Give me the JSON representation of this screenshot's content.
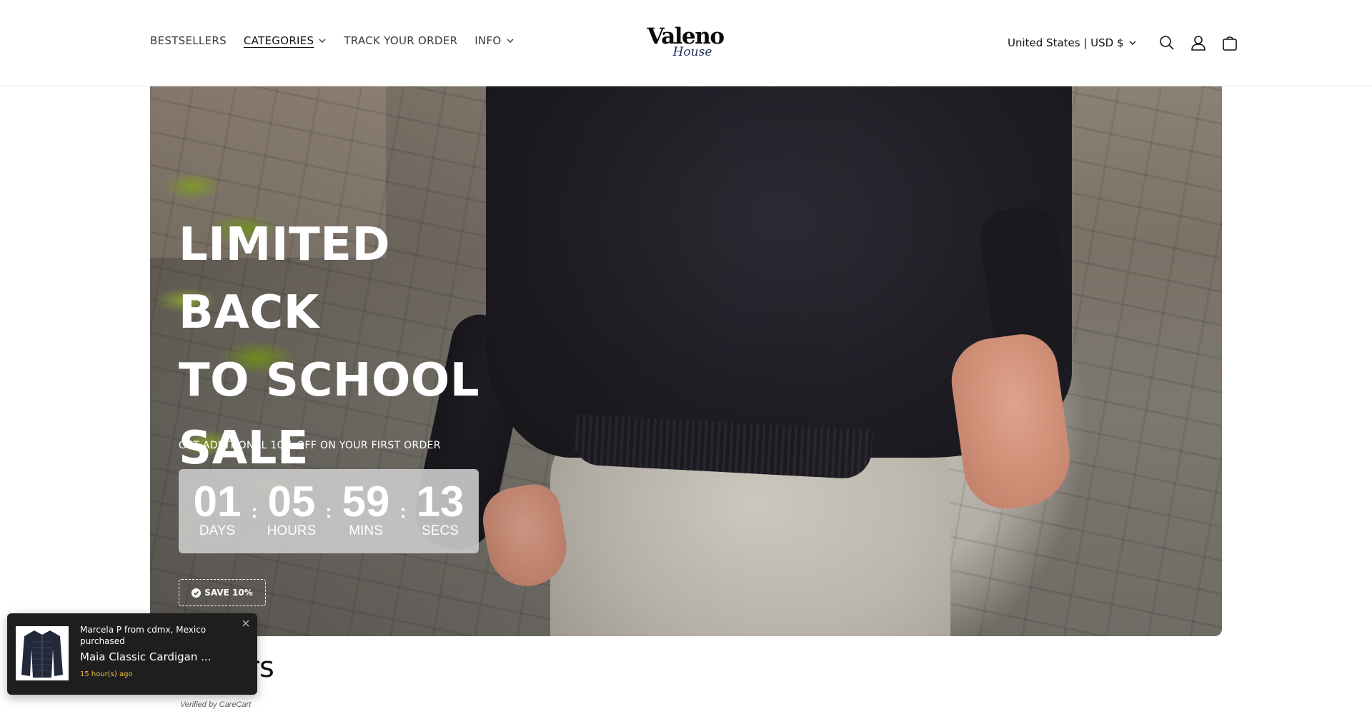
{
  "nav": {
    "items": [
      {
        "label": "BESTSELLERS",
        "has_dropdown": false
      },
      {
        "label": "CATEGORIES",
        "has_dropdown": true,
        "active": true
      },
      {
        "label": "TRACK YOUR ORDER",
        "has_dropdown": false
      },
      {
        "label": "INFO",
        "has_dropdown": true
      }
    ]
  },
  "logo": {
    "main": "Valeno",
    "sub": "House"
  },
  "header_right": {
    "locale": "United States | USD $",
    "icons": [
      "search-icon",
      "account-icon",
      "cart-icon"
    ]
  },
  "hero": {
    "title_lines": [
      "LIMITED BACK",
      "TO SCHOOL",
      "SALE"
    ],
    "subtitle": "GET ADDITIONAL 10% OFF ON YOUR FIRST ORDER",
    "countdown": [
      {
        "value": "01",
        "label": "DAYS"
      },
      {
        "value": "05",
        "label": "HOURS"
      },
      {
        "value": "59",
        "label": "MINS"
      },
      {
        "value": "13",
        "label": "SECS"
      }
    ],
    "save_button": "SAVE 10%"
  },
  "section": {
    "title_visible": "ers"
  },
  "popup": {
    "line1": "Marcela P from cdmx, Mexico purchased",
    "product": "Maia Classic Cardigan ...",
    "time": "15 hour(s) ago",
    "verified": "Verified by CareCart"
  },
  "colors": {
    "accent_time": "#f0c14b",
    "popup_bg": "#1e1e1e",
    "countdown_bg": "#c8c8c8"
  }
}
